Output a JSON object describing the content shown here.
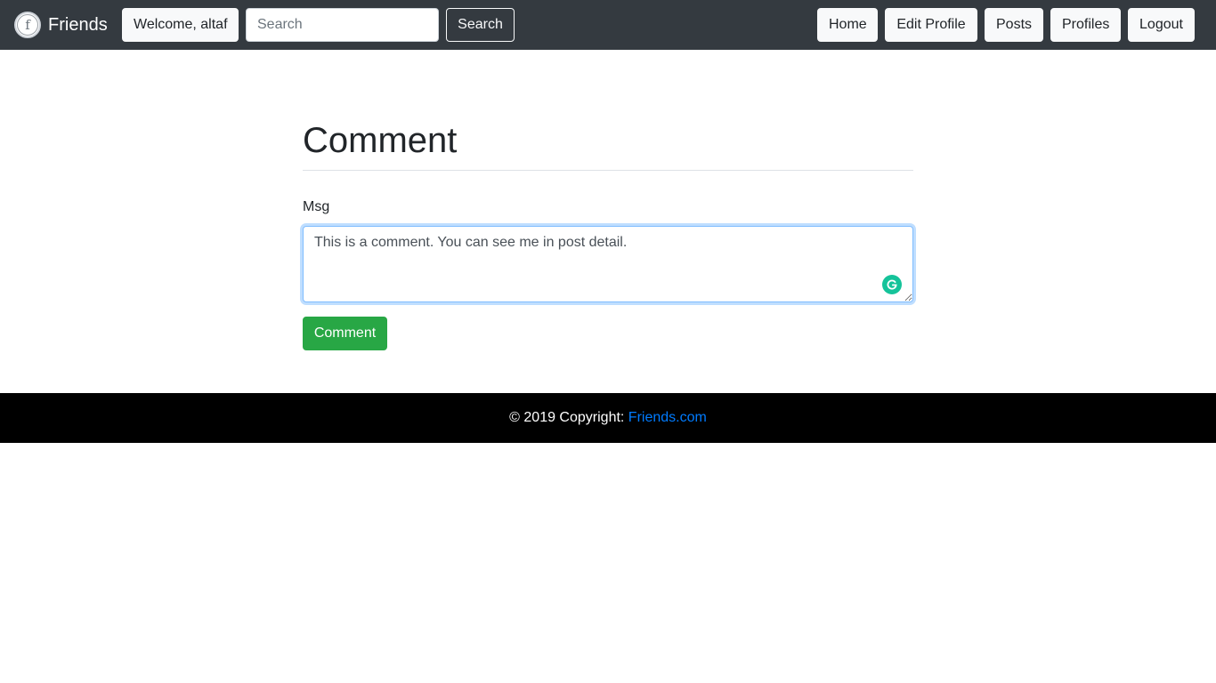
{
  "navbar": {
    "brand": "Friends",
    "welcome": "Welcome, altaf",
    "search_placeholder": "Search",
    "search_button": "Search",
    "links": {
      "home": "Home",
      "edit_profile": "Edit Profile",
      "posts": "Posts",
      "profiles": "Profiles",
      "logout": "Logout"
    }
  },
  "form": {
    "title": "Comment",
    "msg_label": "Msg",
    "msg_value": "This is a comment. You can see me in post detail.",
    "submit": "Comment"
  },
  "footer": {
    "text": "© 2019 Copyright: ",
    "link": "Friends.com"
  },
  "colors": {
    "navbar_bg": "#343a40",
    "success": "#28a745",
    "link": "#007bff",
    "footer_bg": "#000000",
    "grammarly": "#15c39a"
  },
  "icons": {
    "brand_logo": "facebook-circle-icon",
    "textarea_assistant": "grammarly-icon"
  }
}
